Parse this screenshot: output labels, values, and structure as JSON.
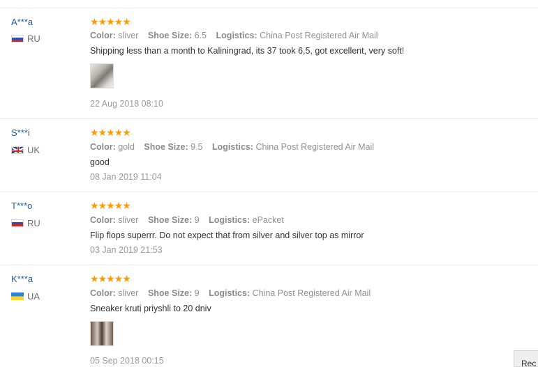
{
  "reviews": [
    {
      "name": "A***a",
      "country": "RU",
      "flag": "flag-ru",
      "rating": 5,
      "stars": "★★★★★",
      "color_label": "Color:",
      "color_value": "sliver",
      "size_label": "Shoe Size:",
      "size_value": "6.5",
      "logistics_label": "Logistics:",
      "logistics_value": "China Post Registered Air Mail",
      "text": "Shipping less than a month to Kaliningrad, its 37 took 6,5, got excellent, very soft!",
      "date": "22 Aug 2018 08:10",
      "has_photo": true
    },
    {
      "name": "S***i",
      "country": "UK",
      "flag": "flag-uk",
      "rating": 5,
      "stars": "★★★★★",
      "color_label": "Color:",
      "color_value": "gold",
      "size_label": "Shoe Size:",
      "size_value": "9.5",
      "logistics_label": "Logistics:",
      "logistics_value": "China Post Registered Air Mail",
      "text": "good",
      "date": "08 Jan 2019 11:04",
      "has_photo": false
    },
    {
      "name": "T***o",
      "country": "RU",
      "flag": "flag-ru",
      "rating": 5,
      "stars": "★★★★★",
      "color_label": "Color:",
      "color_value": "sliver",
      "size_label": "Shoe Size:",
      "size_value": "9",
      "logistics_label": "Logistics:",
      "logistics_value": "ePacket",
      "text": "Flip flops superrr. Do not expect that from silver and silver top as mirror",
      "date": "03 Jan 2019 21:53",
      "has_photo": false
    },
    {
      "name": "K***a",
      "country": "UA",
      "flag": "flag-ua",
      "rating": 5,
      "stars": "★★★★★",
      "color_label": "Color:",
      "color_value": "sliver",
      "size_label": "Shoe Size:",
      "size_value": "9",
      "logistics_label": "Logistics:",
      "logistics_value": "China Post Registered Air Mail",
      "text": "Sneaker kruti priyshli to 20 dniv",
      "date": "05 Sep 2018 00:15",
      "has_photo": true
    }
  ],
  "corner_button": {
    "label": "Rec"
  },
  "colors": {
    "star": "#ff9a00",
    "name_link": "#1f5fa8"
  }
}
